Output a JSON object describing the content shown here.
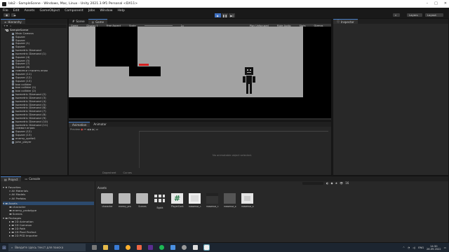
{
  "window": {
    "title": "lab2 - SampleScene - Windows, Mac, Linux - Unity 2021.3.9f1 Personal <DX11>",
    "controls": [
      "–",
      "□",
      "✕"
    ]
  },
  "menu": [
    "File",
    "Edit",
    "Assets",
    "GameObject",
    "Component",
    "Jobs",
    "Window",
    "Help"
  ],
  "toolbar": {
    "layers": "Layers",
    "layout": "Layout",
    "play": "▶",
    "pause": "❚❚",
    "step": "▶|"
  },
  "hierarchy": {
    "tab": "Hierarchy",
    "scene": "SampleScene",
    "items": [
      "Main Camera",
      "Square",
      "Square",
      "Square (1)",
      "Square",
      "Isometric Diamond",
      "Isometric Diamond (1)",
      "Square (4)",
      "Square (5)",
      "Square (7)",
      "Square (8)",
      "новинки строить игры",
      "Square (11)",
      "Square (12)",
      "Square (13)",
      "box collider",
      "box collider (1)",
      "box collider (2)",
      "Isometric Diamond (2)",
      "Isometric Diamond (3)",
      "Isometric Diamond (4)",
      "Isometric Diamond (5)",
      "Isometric Diamond (6)",
      "Isometric Diamond (7)",
      "Isometric Diamond (8)",
      "Isometric Diamond (9)",
      "Isometric Diamond (10)",
      "Isometric Diamond (11)",
      "символ игрок",
      "Square (12)",
      "Square (13)",
      "enemy_sprite1",
      "john_player"
    ]
  },
  "scene_view": {
    "tabs": [
      "Scene",
      "Game"
    ],
    "bar": {
      "display": "Game",
      "display_num": "Display 1",
      "aspect": "Free Aspect",
      "scale_label": "Scale",
      "scale_value": "1x",
      "play_mode": "Play Unfocused",
      "mute": "Mute Audio",
      "stats": "Stats",
      "gizmos": "Gizmos"
    }
  },
  "animation": {
    "tabs": [
      "Animation",
      "Animator"
    ],
    "preview": "Preview",
    "empty_msg": "No animatable object selected.",
    "bottom_tabs": [
      "Dopesheet",
      "Curves"
    ]
  },
  "inspector": {
    "tab": "Inspector"
  },
  "project": {
    "tabs": [
      "Project",
      "Console"
    ],
    "favorites": {
      "title": "Favorites",
      "items": [
        "All Materials",
        "All Models",
        "All Prefabs"
      ]
    },
    "assets": {
      "title": "Assets",
      "items": [
        "character",
        "enemy_prototype",
        "Scenes"
      ]
    },
    "packages": {
      "title": "Packages",
      "items": [
        "2D Animation",
        "2D Common",
        "2D Path",
        "2D Pixel Perfect",
        "2D PSD Importer"
      ]
    },
    "breadcrumb": "Assets",
    "grid": [
      {
        "label": "character",
        "kind": "folder"
      },
      {
        "label": "enemy_pro...",
        "kind": "folder"
      },
      {
        "label": "Scenes",
        "kind": "folder"
      },
      {
        "label": "Bgblk",
        "kind": "sprite"
      },
      {
        "label": "PlayerCont...",
        "kind": "script"
      },
      {
        "label": "новинки_гл...",
        "kind": "image"
      },
      {
        "label": "новинки_гл...",
        "kind": "image-dark"
      },
      {
        "label": "новинки_кв...",
        "kind": "image-dark"
      },
      {
        "label": "новинки_кв...",
        "kind": "image"
      }
    ],
    "slider_count": "16"
  },
  "taskbar": {
    "search_placeholder": "Введите здесь текст для поиска",
    "lang": "ENG",
    "time": "14:30",
    "date": "26.09.2022"
  },
  "colors": {
    "accent": "#3e6fbf",
    "scene_sky": "#a2a2a2",
    "red_marker": "#d32020",
    "panel": "#282828"
  }
}
